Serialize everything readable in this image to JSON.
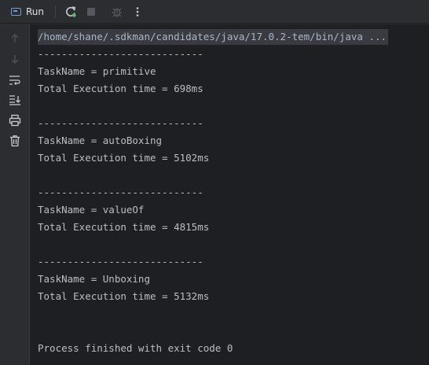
{
  "toolbar": {
    "run_tab_label": "Run"
  },
  "console": {
    "command": "/home/shane/.sdkman/candidates/java/17.0.2-tem/bin/java ...",
    "separator": "----------------------------",
    "results": [
      {
        "task_line": "TaskName = primitive",
        "time_line": "Total Execution time = 698ms"
      },
      {
        "task_line": "TaskName = autoBoxing",
        "time_line": "Total Execution time = 5102ms"
      },
      {
        "task_line": "TaskName = valueOf",
        "time_line": "Total Execution time = 4815ms"
      },
      {
        "task_line": "TaskName = Unboxing",
        "time_line": "Total Execution time = 5132ms"
      }
    ],
    "exit_message": "Process finished with exit code 0"
  },
  "colors": {
    "background": "#2b2d30",
    "console_bg": "#1e1f22",
    "text": "#bcbec4",
    "rerun_green": "#5fb865"
  }
}
